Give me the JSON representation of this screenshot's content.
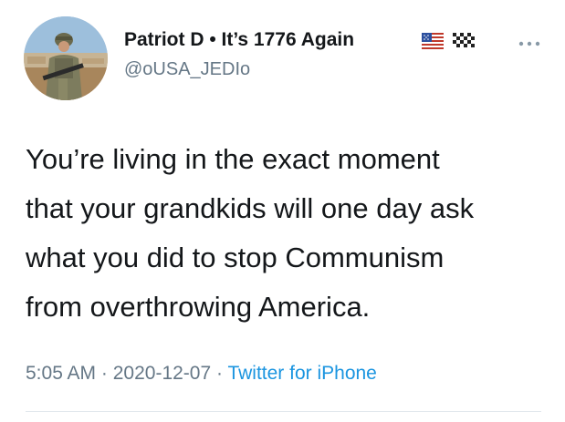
{
  "tweet": {
    "author": {
      "display_name": "Patriot D • It’s 1776 Again",
      "handle": "@oUSA_JEDIo",
      "name_emojis": [
        "us-flag-icon",
        "checkered-flag-icon"
      ]
    },
    "text_lines": [
      "You’re living in the exact moment",
      "that your grandkids will one day ask",
      "what you did to stop Communism",
      "from overthrowing America."
    ],
    "time": "5:05 AM",
    "separator": " · ",
    "date": "2020-12-07",
    "source": "Twitter for iPhone"
  },
  "colors": {
    "text_primary": "#14171a",
    "text_secondary": "#657786",
    "link": "#1b95e0",
    "divider": "#e1e8ed"
  },
  "icons": {
    "more": "more-options-icon"
  }
}
